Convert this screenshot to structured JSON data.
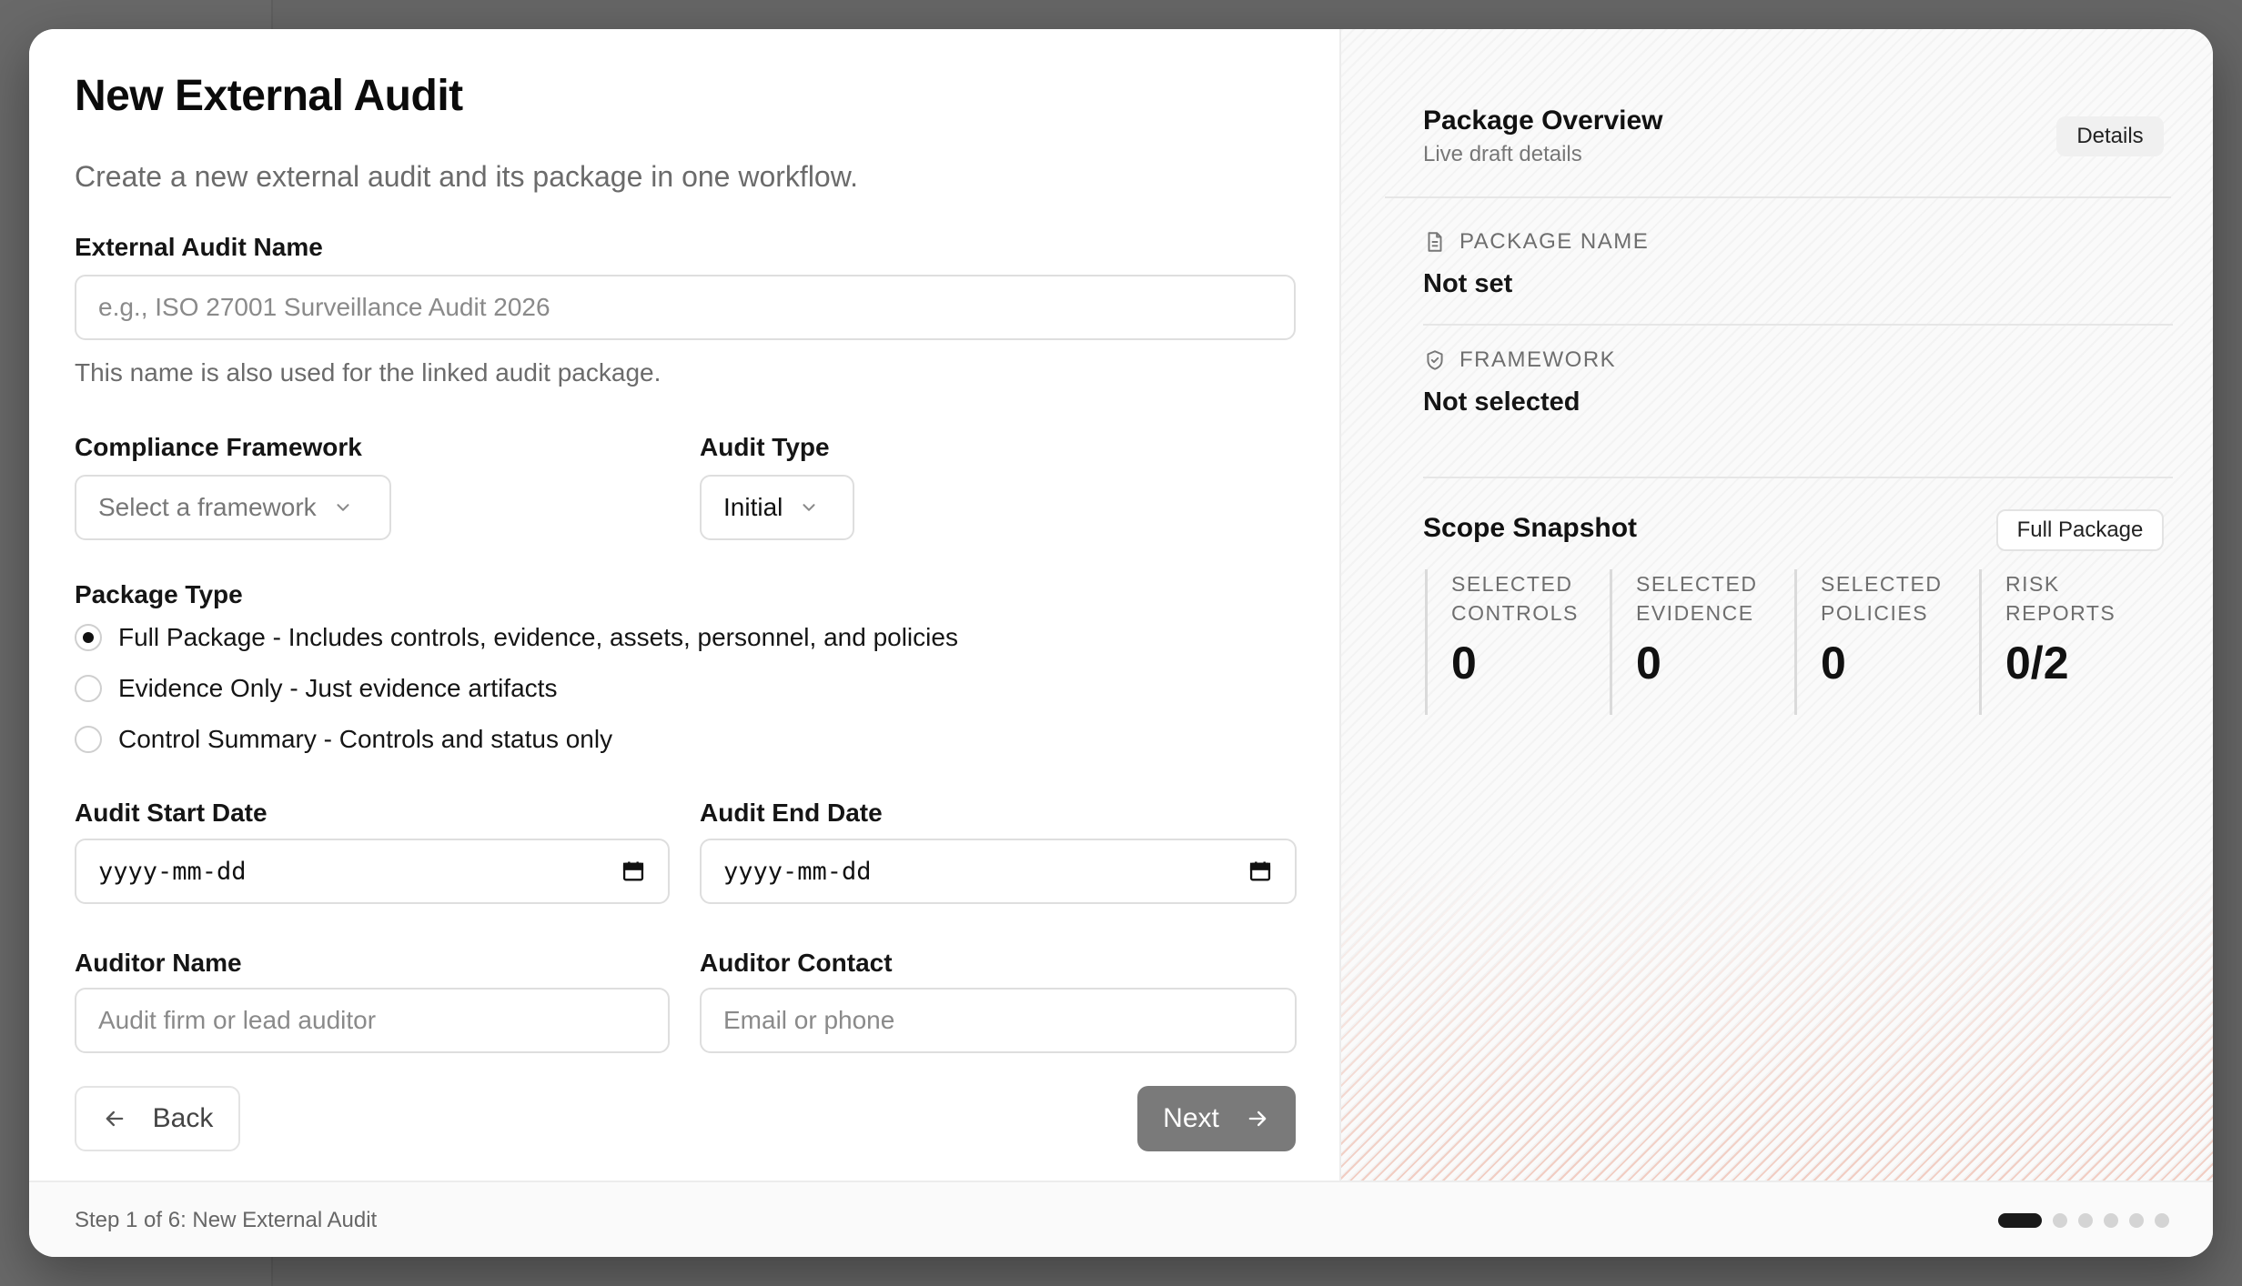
{
  "modal": {
    "title": "New External Audit",
    "subtitle": "Create a new external audit and its package in one workflow."
  },
  "form": {
    "audit_name": {
      "label": "External Audit Name",
      "placeholder": "e.g., ISO 27001 Surveillance Audit 2026",
      "hint": "This name is also used for the linked audit package."
    },
    "framework": {
      "label": "Compliance Framework",
      "value": "Select a framework"
    },
    "audit_type": {
      "label": "Audit Type",
      "value": "Initial"
    },
    "package_type": {
      "label": "Package Type",
      "options": [
        {
          "label": "Full Package - Includes controls, evidence, assets, personnel, and policies",
          "selected": true
        },
        {
          "label": "Evidence Only - Just evidence artifacts",
          "selected": false
        },
        {
          "label": "Control Summary - Controls and status only",
          "selected": false
        }
      ]
    },
    "start_date": {
      "label": "Audit Start Date",
      "value": "yyyy-mm-dd"
    },
    "end_date": {
      "label": "Audit End Date",
      "value": "yyyy-mm-dd"
    },
    "auditor_name": {
      "label": "Auditor Name",
      "placeholder": "Audit firm or lead auditor"
    },
    "auditor_contact": {
      "label": "Auditor Contact",
      "placeholder": "Email or phone"
    },
    "back_label": "Back",
    "next_label": "Next"
  },
  "overview": {
    "title": "Package Overview",
    "subtitle": "Live draft details",
    "details_label": "Details",
    "package_name": {
      "label": "PACKAGE NAME",
      "value": "Not set"
    },
    "framework": {
      "label": "FRAMEWORK",
      "value": "Not selected"
    },
    "scope": {
      "title": "Scope Snapshot",
      "badge": "Full Package",
      "stats": [
        {
          "label_line1": "SELECTED",
          "label_line2": "CONTROLS",
          "value": "0"
        },
        {
          "label_line1": "SELECTED",
          "label_line2": "EVIDENCE",
          "value": "0"
        },
        {
          "label_line1": "SELECTED",
          "label_line2": "POLICIES",
          "value": "0"
        },
        {
          "label_line1": "RISK",
          "label_line2": "REPORTS",
          "value": "0/2"
        }
      ]
    }
  },
  "footer": {
    "step_text": "Step 1 of 6: New External Audit",
    "total_steps": 6,
    "current_step": 1
  },
  "colors": {
    "next_button": "#7a7a7a",
    "accent_glow": "#e2785a"
  }
}
